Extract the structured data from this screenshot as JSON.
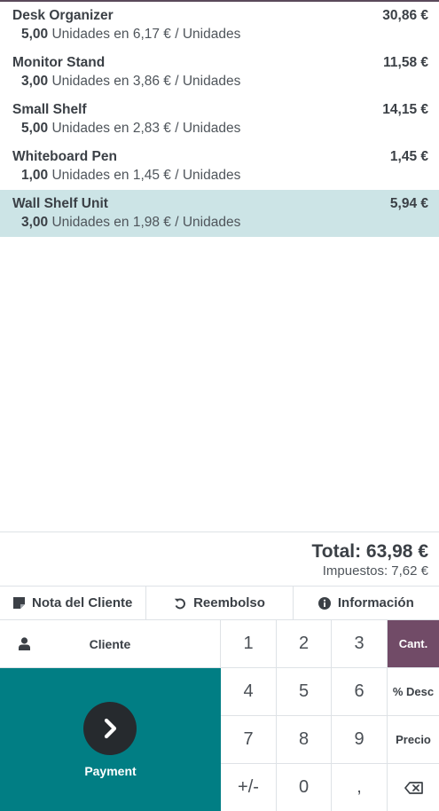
{
  "orderlines": [
    {
      "name": "Desk Organizer",
      "price": "30,86 €",
      "qty": "5,00",
      "unit_text": " Unidades en 6,17 € / Unidades",
      "selected": false
    },
    {
      "name": "Monitor Stand",
      "price": "11,58 €",
      "qty": "3,00",
      "unit_text": " Unidades en 3,86 € / Unidades",
      "selected": false
    },
    {
      "name": "Small Shelf",
      "price": "14,15 €",
      "qty": "5,00",
      "unit_text": " Unidades en 2,83 € / Unidades",
      "selected": false
    },
    {
      "name": "Whiteboard Pen",
      "price": "1,45 €",
      "qty": "1,00",
      "unit_text": " Unidades en 1,45 € / Unidades",
      "selected": false
    },
    {
      "name": "Wall Shelf Unit",
      "price": "5,94 €",
      "qty": "3,00",
      "unit_text": " Unidades en 1,98 € / Unidades",
      "selected": true
    }
  ],
  "summary": {
    "total": "Total: 63,98 €",
    "taxes": "Impuestos: 7,62 €"
  },
  "controls": {
    "customer_note": "Nota del Cliente",
    "refund": "Reembolso",
    "info": "Información"
  },
  "customer_label": "Cliente",
  "payment_label": "Payment",
  "numpad": {
    "digits": [
      "1",
      "2",
      "3",
      "4",
      "5",
      "6",
      "7",
      "8",
      "9",
      "+/-",
      "0",
      ","
    ],
    "modes": [
      "Cant.",
      "% Desc",
      "Precio"
    ],
    "active_mode": "Cant."
  },
  "colors": {
    "selected_line": "#cce4e6",
    "payment_bg": "#017e84",
    "active_mode": "#714b67"
  },
  "icons": {
    "customer_note": "sticky-note-icon",
    "refund": "undo-icon",
    "info": "info-circle-icon",
    "customer": "user-icon",
    "payment": "chevron-right-icon",
    "backspace": "backspace-icon"
  }
}
